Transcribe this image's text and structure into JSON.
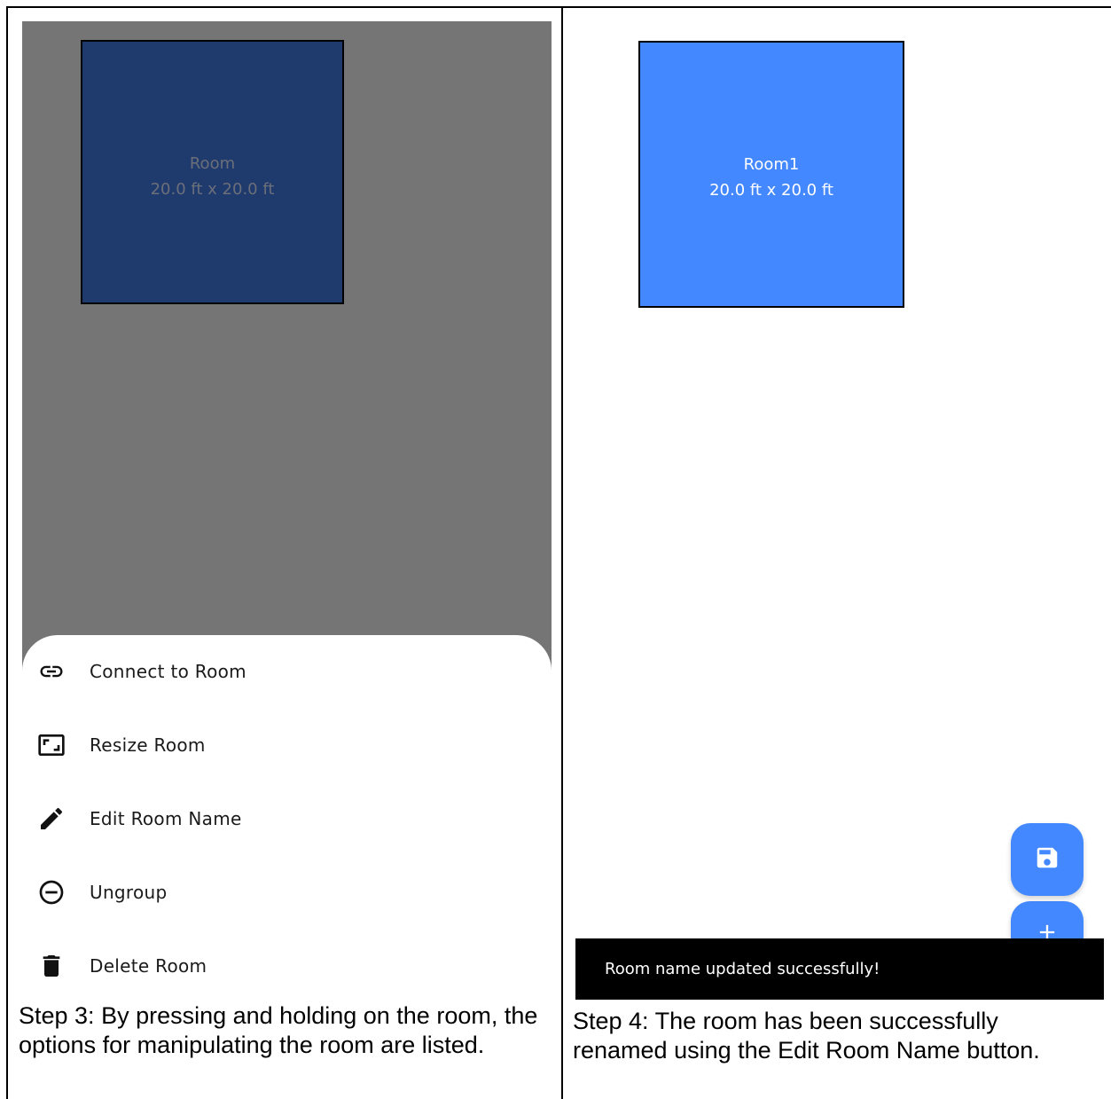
{
  "left_panel": {
    "room": {
      "name": "Room",
      "size": "20.0 ft x 20.0 ft"
    },
    "menu": [
      {
        "label": "Connect to Room",
        "icon": "link-icon"
      },
      {
        "label": "Resize Room",
        "icon": "aspect-ratio-icon"
      },
      {
        "label": "Edit Room Name",
        "icon": "pencil-icon"
      },
      {
        "label": "Ungroup",
        "icon": "remove-circle-icon"
      },
      {
        "label": "Delete Room",
        "icon": "trash-icon"
      }
    ],
    "caption": "Step 3: By pressing and holding on the room, the options for manipulating the room are listed."
  },
  "right_panel": {
    "room": {
      "name": "Room1",
      "size": "20.0 ft x 20.0 ft"
    },
    "fab_save_icon": "save-icon",
    "fab_add_icon": "plus-icon",
    "snackbar": "Room name updated successfully!",
    "caption": "Step 4: The room has been successfully renamed using the Edit Room Name button."
  },
  "colors": {
    "scrim": "#757575",
    "room_dimmed": "#1f3a6d",
    "room_active": "#4488ff",
    "snackbar_bg": "#000000"
  }
}
